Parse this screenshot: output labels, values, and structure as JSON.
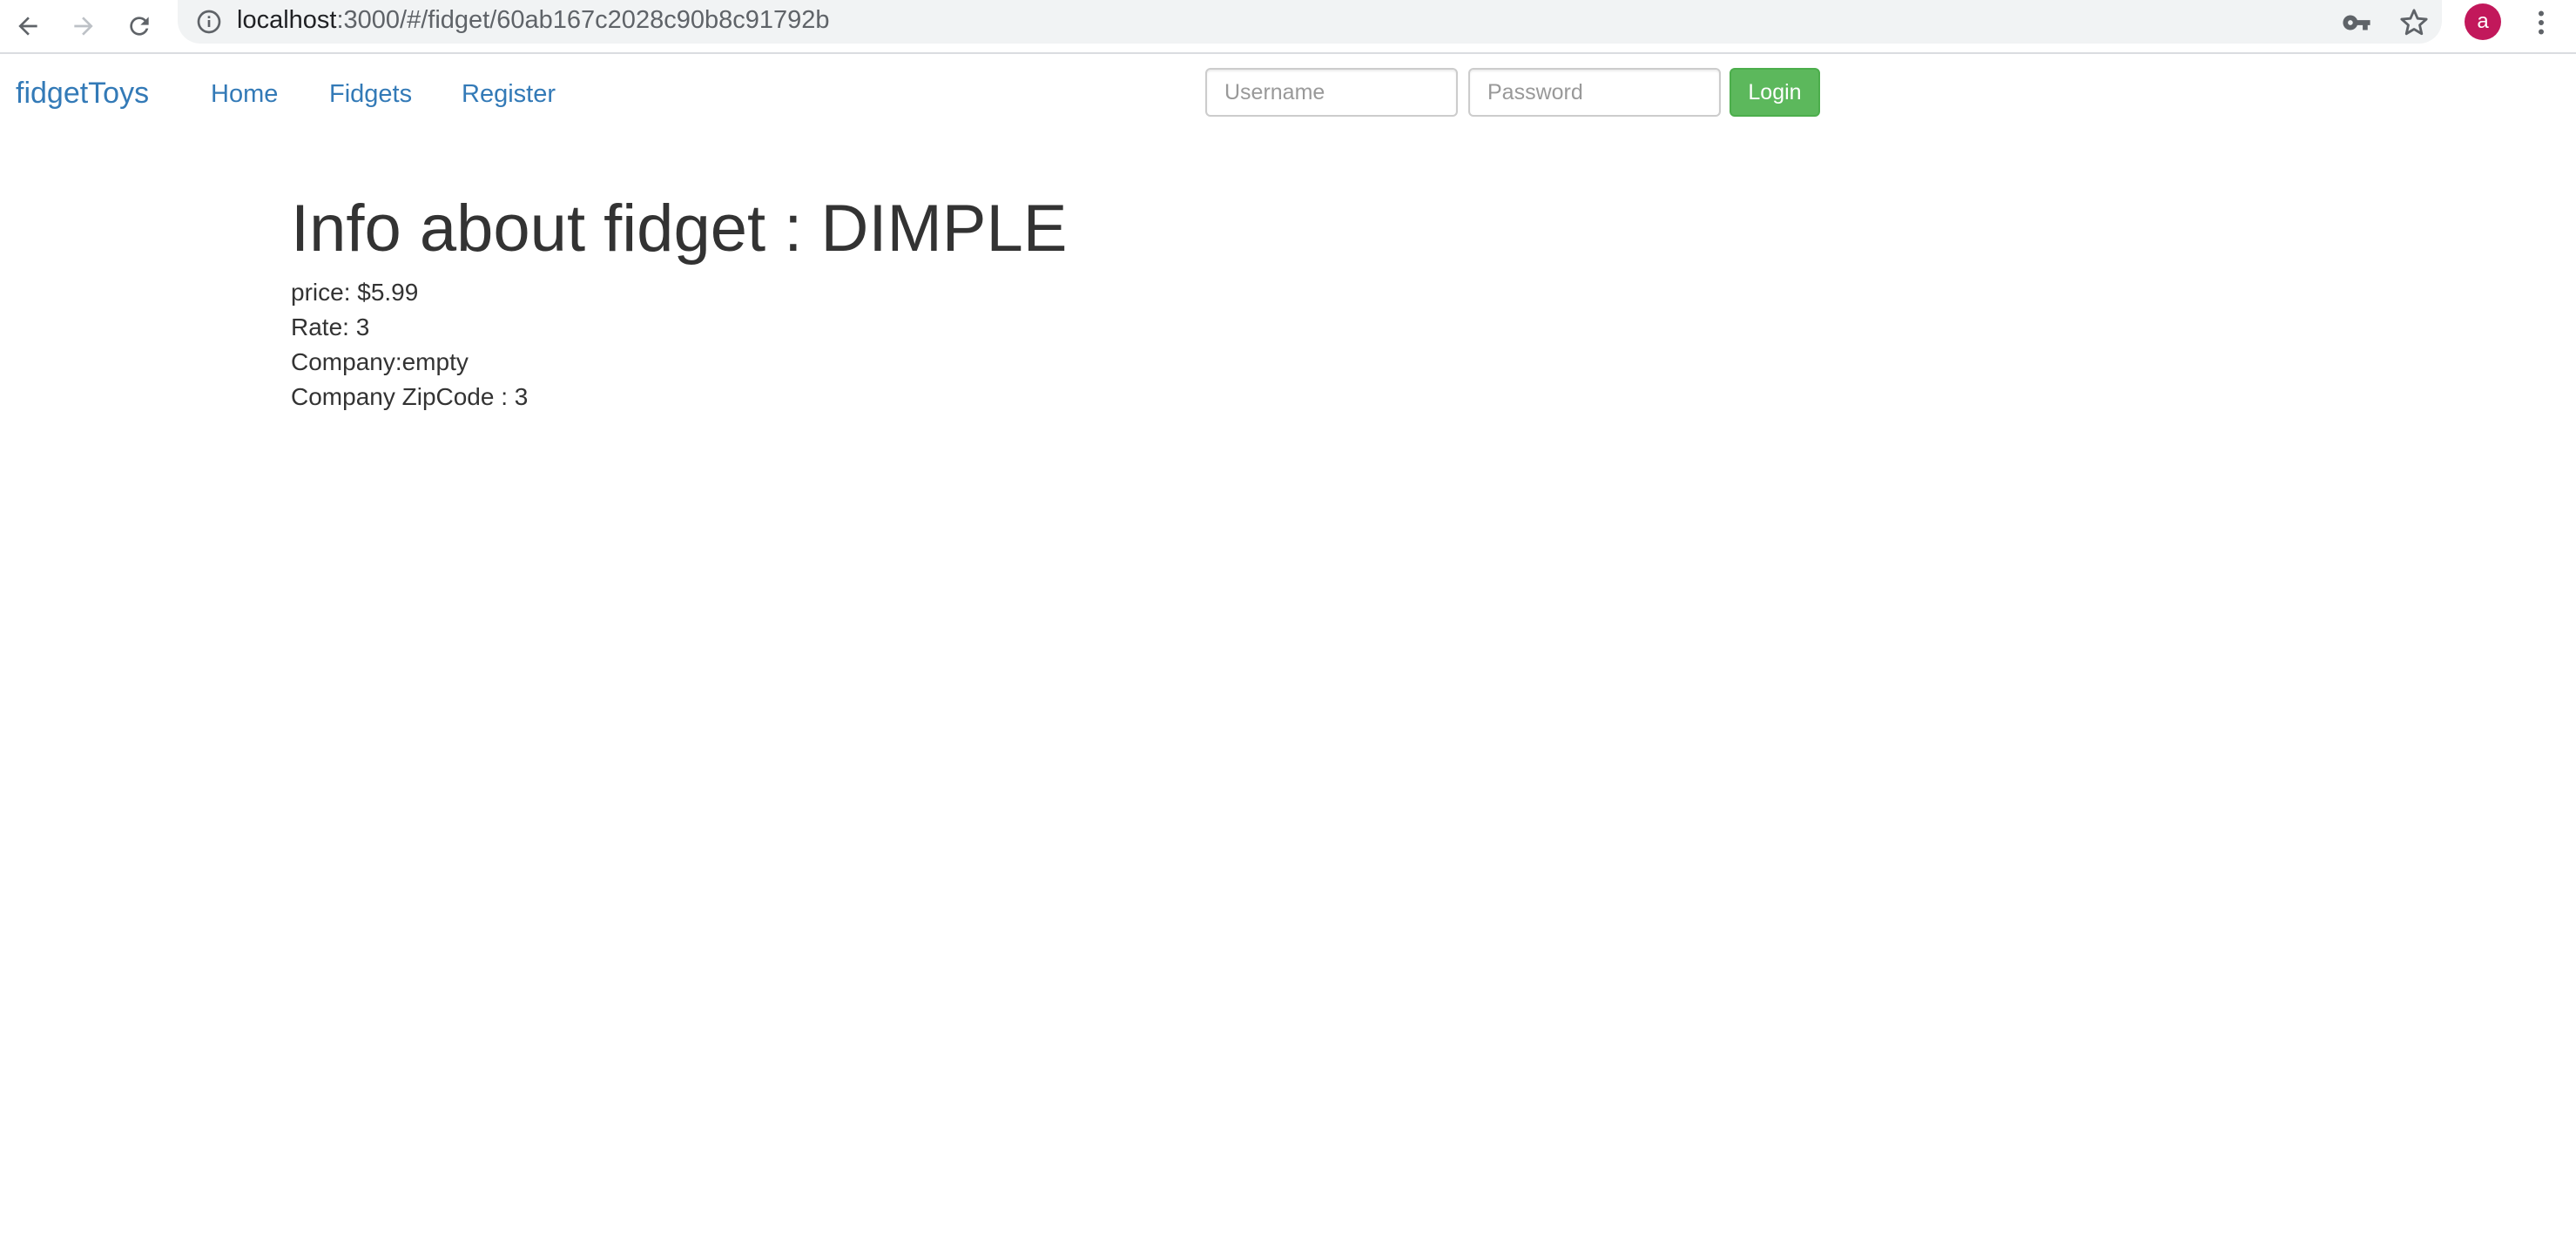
{
  "browser": {
    "url_host": "localhost",
    "url_rest": ":3000/#/fidget/60ab167c2028c90b8c91792b",
    "avatar_letter": "a",
    "icons": [
      "back-arrow-icon",
      "forward-arrow-icon",
      "reload-icon",
      "info-icon",
      "key-icon",
      "star-icon",
      "kebab-menu-icon"
    ]
  },
  "navbar": {
    "brand": "fidgetToys",
    "links": [
      "Home",
      "Fidgets",
      "Register"
    ],
    "username_placeholder": "Username",
    "password_placeholder": "Password",
    "login_label": "Login",
    "login_color": "#5cb85c",
    "link_color": "#337ab7"
  },
  "fidget": {
    "title": "Info about fidget : DIMPLE",
    "price": "price: $5.99",
    "rate": "Rate: 3",
    "company": "Company:empty",
    "zipcode": "Company ZipCode : 3"
  }
}
